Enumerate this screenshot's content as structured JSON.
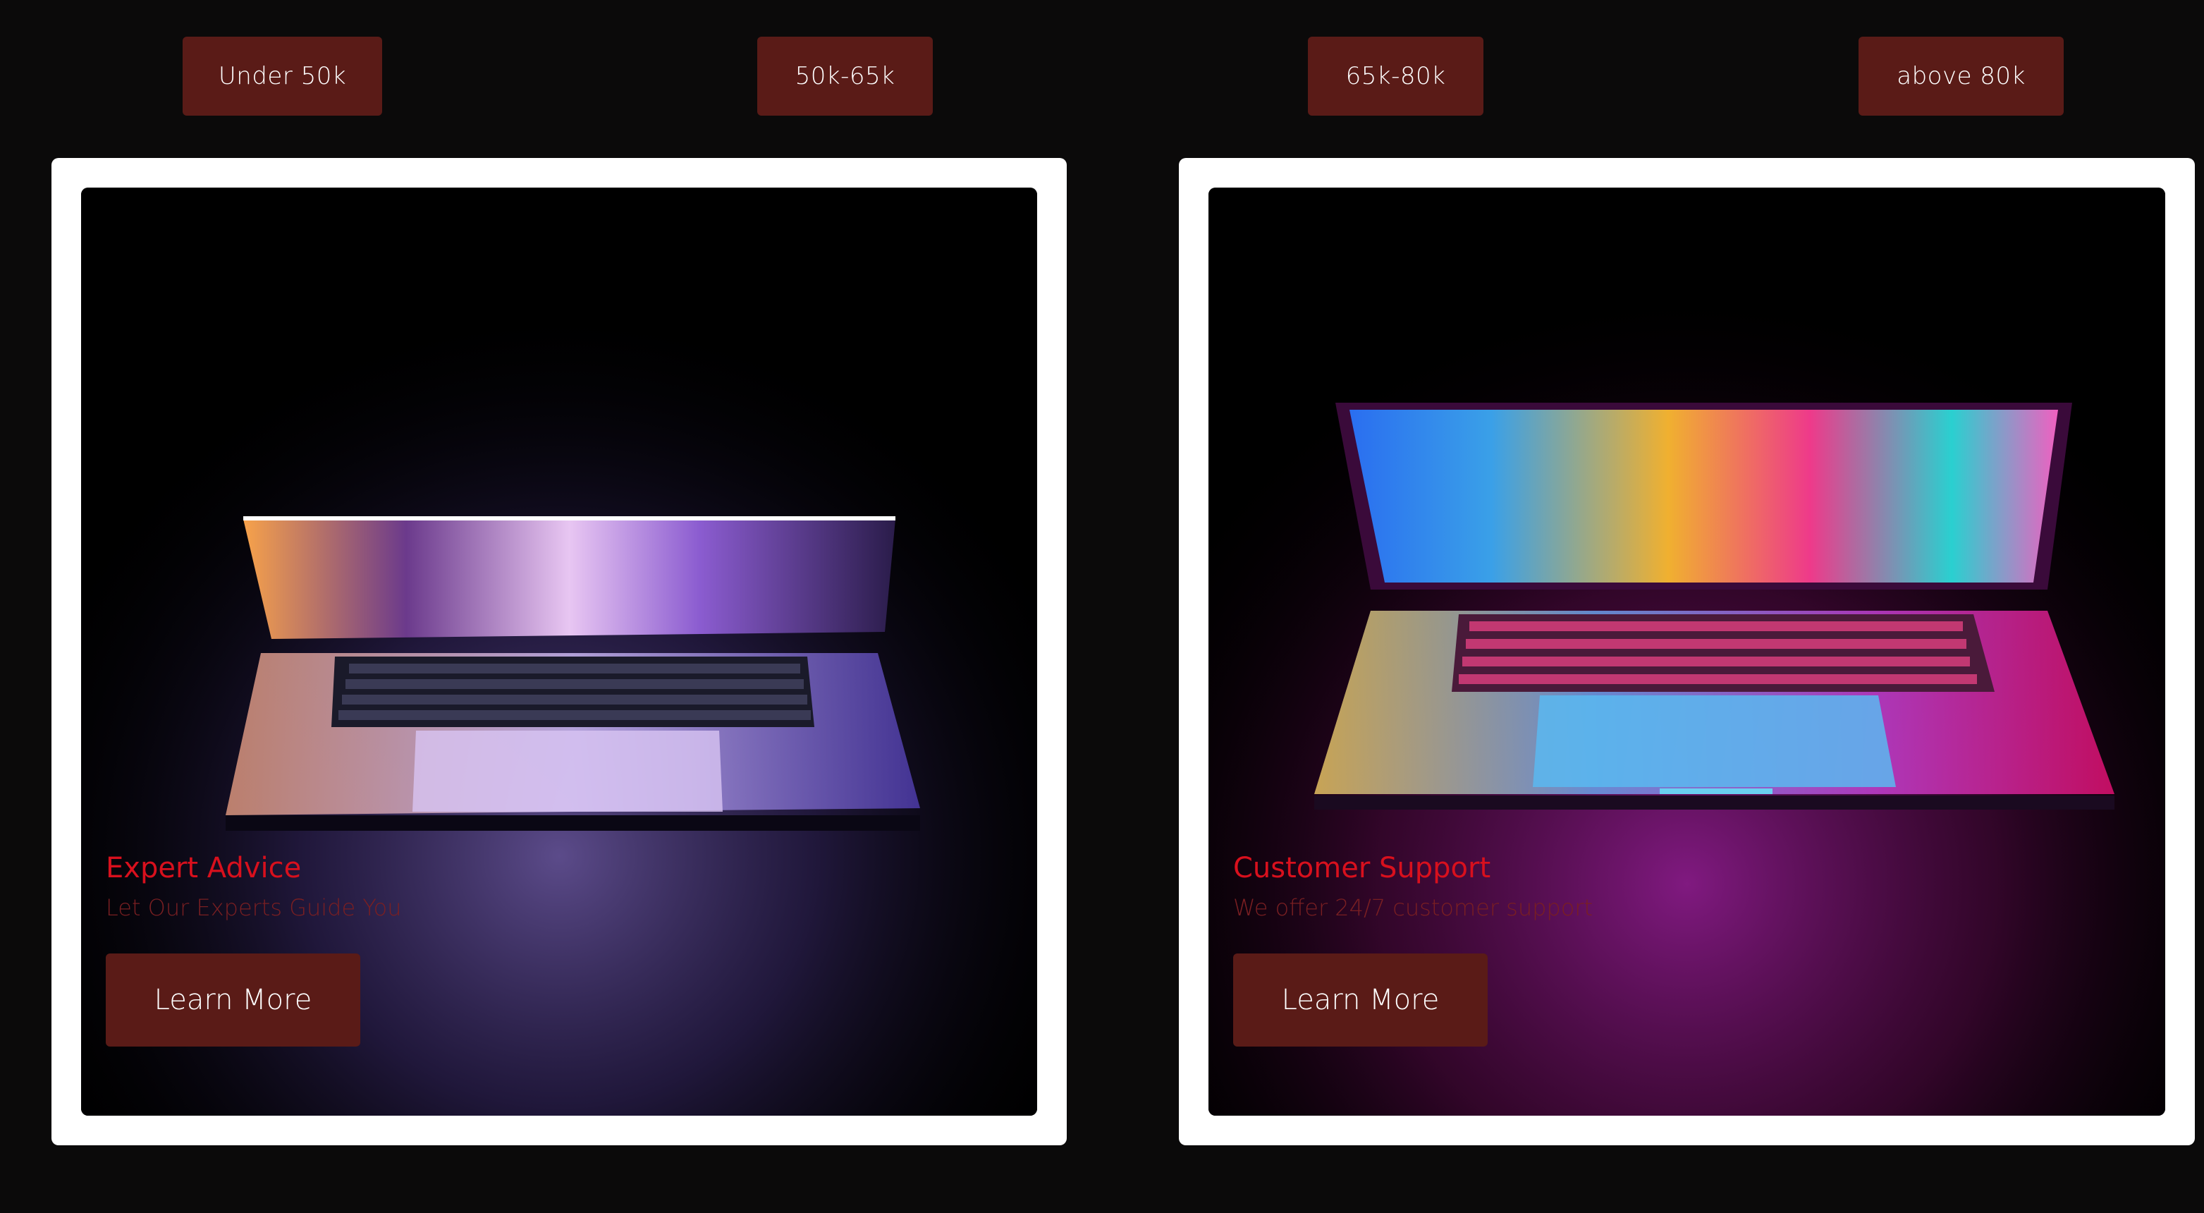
{
  "price_filters": [
    {
      "label": "Under 50k"
    },
    {
      "label": "50k-65k"
    },
    {
      "label": "65k-80k"
    },
    {
      "label": "above 80k"
    }
  ],
  "cards": [
    {
      "title": "Expert Advice",
      "subtitle": "Let Our Experts Guide You",
      "button_label": "Learn More",
      "image": "laptop-half-open-purple-photo"
    },
    {
      "title": "Customer Support",
      "subtitle": "We offer 24/7 customer support",
      "button_label": "Learn More",
      "image": "laptop-open-colorful-photo"
    }
  ],
  "colors": {
    "page_background": "#0b0a0a",
    "button_background": "#5a1b17",
    "card_title": "#d8101d",
    "card_subtitle": "#7a1f22",
    "card_frame": "#ffffff"
  }
}
